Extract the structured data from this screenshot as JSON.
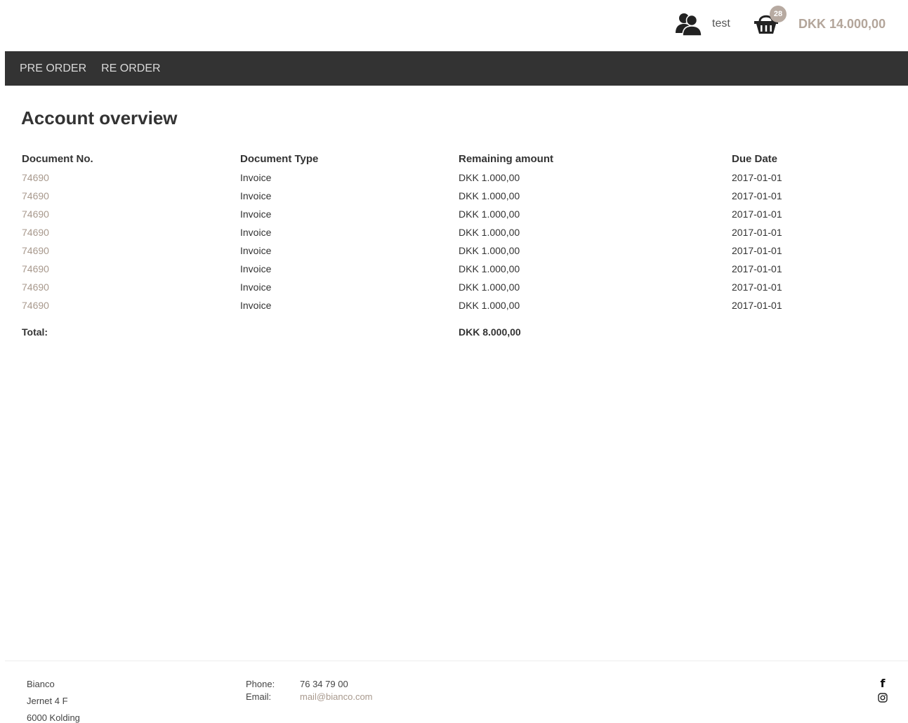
{
  "header": {
    "user_name": "test",
    "basket_count": "28",
    "basket_total": "DKK 14.000,00"
  },
  "nav": {
    "items": [
      {
        "label": "PRE ORDER"
      },
      {
        "label": "RE ORDER"
      }
    ]
  },
  "main": {
    "title": "Account overview",
    "columns": [
      "Document No.",
      "Document Type",
      "Remaining amount",
      "Due Date"
    ],
    "rows": [
      {
        "doc_no": "74690",
        "type": "Invoice",
        "amount": "DKK 1.000,00",
        "due": "2017-01-01"
      },
      {
        "doc_no": "74690",
        "type": "Invoice",
        "amount": "DKK 1.000,00",
        "due": "2017-01-01"
      },
      {
        "doc_no": "74690",
        "type": "Invoice",
        "amount": "DKK 1.000,00",
        "due": "2017-01-01"
      },
      {
        "doc_no": "74690",
        "type": "Invoice",
        "amount": "DKK 1.000,00",
        "due": "2017-01-01"
      },
      {
        "doc_no": "74690",
        "type": "Invoice",
        "amount": "DKK 1.000,00",
        "due": "2017-01-01"
      },
      {
        "doc_no": "74690",
        "type": "Invoice",
        "amount": "DKK 1.000,00",
        "due": "2017-01-01"
      },
      {
        "doc_no": "74690",
        "type": "Invoice",
        "amount": "DKK 1.000,00",
        "due": "2017-01-01"
      },
      {
        "doc_no": "74690",
        "type": "Invoice",
        "amount": "DKK 1.000,00",
        "due": "2017-01-01"
      }
    ],
    "total_label": "Total:",
    "total_amount": "DKK 8.000,00"
  },
  "footer": {
    "company": "Bianco",
    "street": "Jernet 4 F",
    "city": "6000 Kolding",
    "phone_label": "Phone:",
    "phone": "76 34 79 00",
    "email_label": "Email:",
    "email": "mail@bianco.com",
    "social_icons": [
      "facebook-icon",
      "instagram-icon"
    ]
  },
  "colors": {
    "nav_background": "#333333",
    "accent": "#a8998d",
    "badge": "#b7aaa1"
  }
}
